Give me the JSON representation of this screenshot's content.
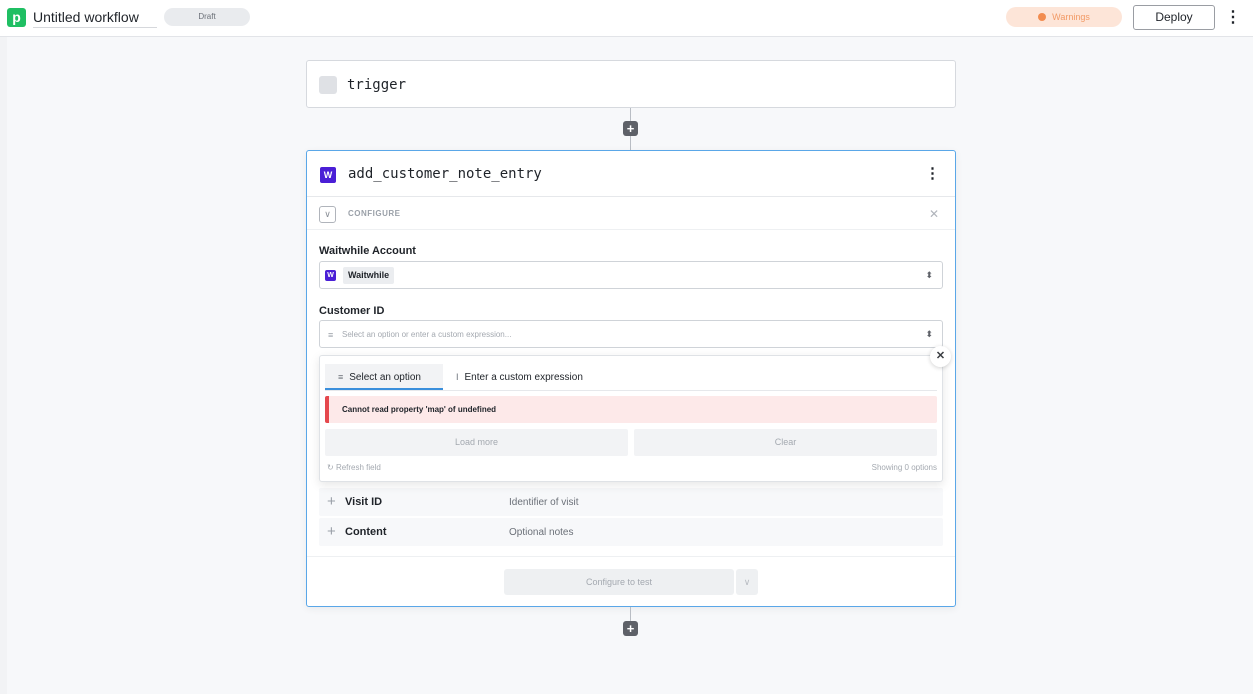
{
  "header": {
    "logo_letter": "p",
    "workflow_title": "Untitled workflow",
    "status_badge": "Draft",
    "warnings_label": "Warnings",
    "deploy_label": "Deploy",
    "menu_icon": "⋮"
  },
  "workflow": {
    "trigger_name": "trigger",
    "add_step_icon": "+",
    "step": {
      "app_icon_letter": "W",
      "name": "add_customer_note_entry",
      "menu_icon": "⋮",
      "configure_label": "CONFIGURE",
      "account": {
        "label": "Waitwhile Account",
        "value": "Waitwhile"
      },
      "customer_id": {
        "label": "Customer ID",
        "placeholder": "Select an option or enter a custom expression..."
      },
      "dropdown": {
        "tab_select": "Select an option",
        "tab_expression": "Enter a custom expression",
        "error": "Cannot read property 'map' of undefined",
        "load_more": "Load more",
        "clear": "Clear",
        "refresh": "Refresh field",
        "showing": "Showing 0 options"
      },
      "params": [
        {
          "name": "Visit ID",
          "description": "Identifier of visit"
        },
        {
          "name": "Content",
          "description": "Optional notes"
        }
      ],
      "test_button": "Configure to test"
    }
  }
}
